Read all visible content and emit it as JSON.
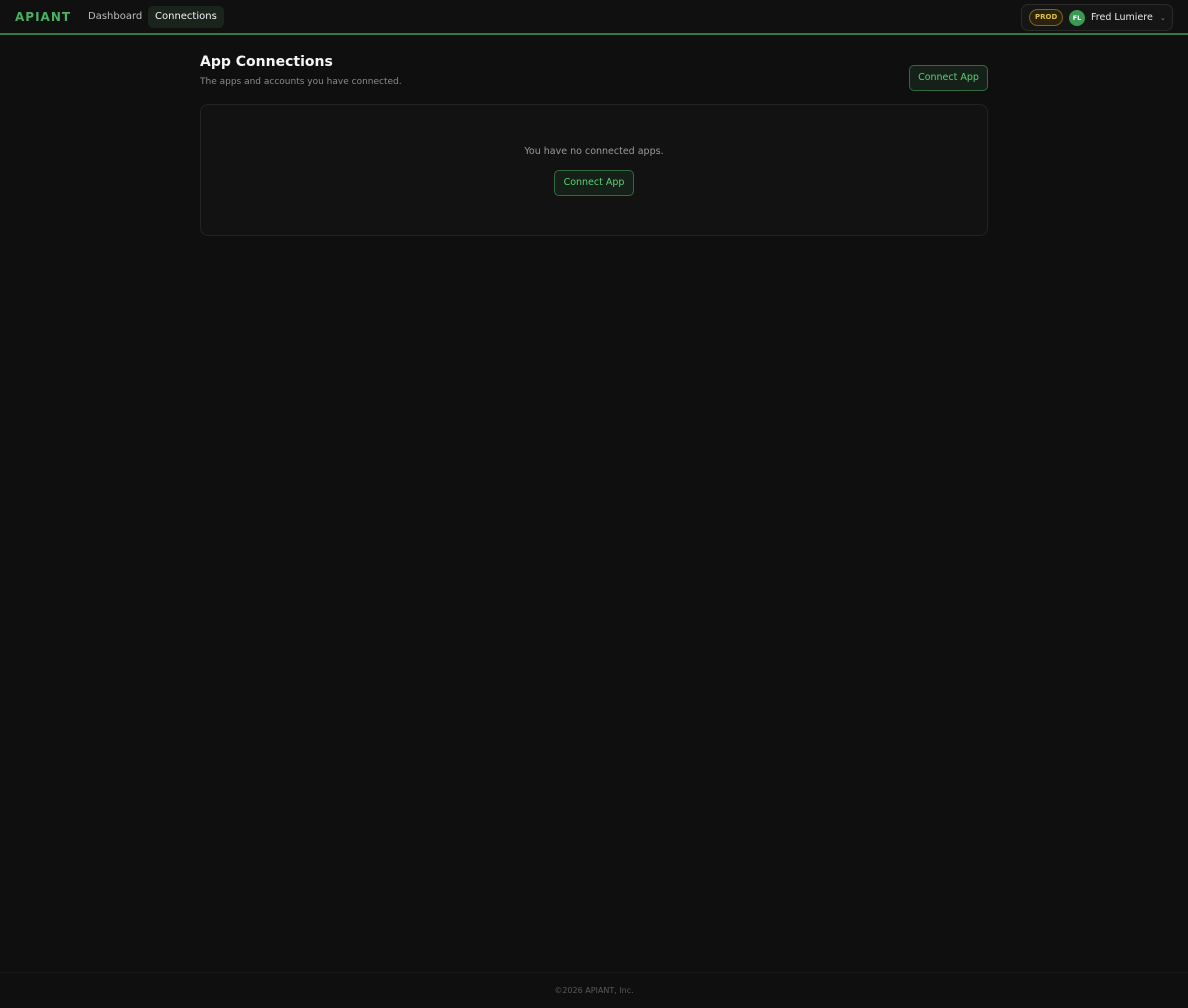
{
  "brand": {
    "logo": "APIANT",
    "accent": "#4caf62"
  },
  "nav": {
    "items": [
      {
        "label": "Dashboard",
        "active": false
      },
      {
        "label": "Connections",
        "active": true
      }
    ]
  },
  "user": {
    "env_badge": "PROD",
    "initials": "FL",
    "name": "Fred Lumiere",
    "menu_icon": "chevron-down-icon"
  },
  "page": {
    "title": "App Connections",
    "subtitle": "The apps and accounts you have connected.",
    "connect_button": "Connect App"
  },
  "empty_state": {
    "message": "You have no connected apps.",
    "button": "Connect App"
  },
  "footer": {
    "text": "©2026 APIANT, Inc."
  }
}
